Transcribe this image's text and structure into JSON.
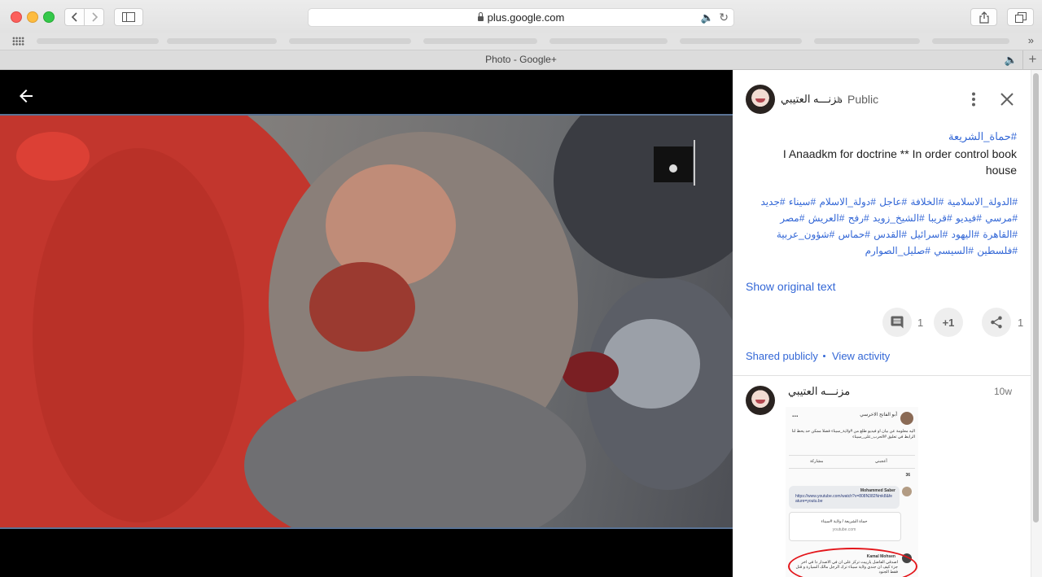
{
  "browser": {
    "url": "plus.google.com",
    "tab_title": "Photo - Google+",
    "back_icon": "chevron-left-icon",
    "forward_icon": "chevron-right-icon",
    "sidebar_icon": "sidebar-icon",
    "share_icon": "share-icon",
    "tabs_icon": "tabs-overview-icon",
    "reload_icon": "reload-icon",
    "speaker_icon": "speaker-icon",
    "bookmarks_icon": "grid-icon",
    "new_tab_icon": "plus-icon",
    "overflow_icon": "double-chevron-right-icon"
  },
  "viewer": {
    "back_icon": "arrow-left-icon",
    "photo_description_icon": "photo"
  },
  "post": {
    "author": "مزنـــه العتيبي",
    "visibility": "Public",
    "top_hashtag": "#حماة_الشريعة",
    "text": "I Anaadkm for  doctrine ** In order  control  book house",
    "hashtags": "#الدولة_الاسلامية #الخلافة #عاجل #دولة_الاسلام #سيناء #جديد #مرسي #فيديو #قريبا #الشيخ_زويد #رفح #العريش #مصر #القاهرة #اليهود #اسرائيل #القدس #حماس #شؤون_عربية #فلسطين #السيسي #صليل_الصوارم",
    "show_original": "Show original text",
    "comments_count": "1",
    "plus_one": "+1",
    "shares_count": "1",
    "shared_publicly": "Shared publicly",
    "view_activity": "View activity"
  },
  "comment": {
    "author": "مزنـــه العتيبي",
    "time": "10w",
    "screenshot": {
      "poster": "أبو الفاتح الاخرسي",
      "more": "...",
      "body": "اليه معلومة عن بيان او فيديو طلع من #ولاية_سيناء فضلا ممكن حد يحط لنا الرابط في تعليق #الحرب_على_سيناء",
      "like": "أعجبني",
      "share": "مشاركة",
      "reactions": "36",
      "commenter1": "Mohammed Saber",
      "link": "https://www.youtube.com/watch?v=808N382Nmk8&feature=youtu.be",
      "card_title": "حماة الشريعة / ولاية #سيناء",
      "card_source": "youtube.com",
      "commenter2": "Kamal Mohsen",
      "reply": "اصدقي الفاضل يارييت تركز علي ان في الاصدار دا في اخر جزء كيف ان جندي ولاية سيناء ترك الرجل مالك السيارة و قتل فقط الجنود"
    }
  },
  "colors": {
    "link": "#3367d6",
    "photo_border": "#5a7395",
    "highlight_ring": "#e3161b"
  }
}
